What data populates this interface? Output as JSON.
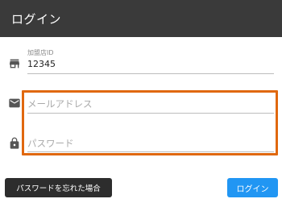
{
  "header": {
    "title": "ログイン"
  },
  "form": {
    "merchant_id": {
      "label": "加盟店ID",
      "value": "12345",
      "icon": "store-icon"
    },
    "email": {
      "placeholder": "メールアドレス",
      "value": "",
      "icon": "mail-icon"
    },
    "password": {
      "placeholder": "パスワード",
      "value": "",
      "icon": "lock-icon"
    }
  },
  "actions": {
    "forgot_password_label": "パスワードを忘れた場合",
    "login_label": "ログイン"
  },
  "colors": {
    "app_bar": "#3a3a3a",
    "highlight": "#e0680f",
    "primary_button": "#2196f3",
    "dark_button": "#2d2d2d"
  }
}
